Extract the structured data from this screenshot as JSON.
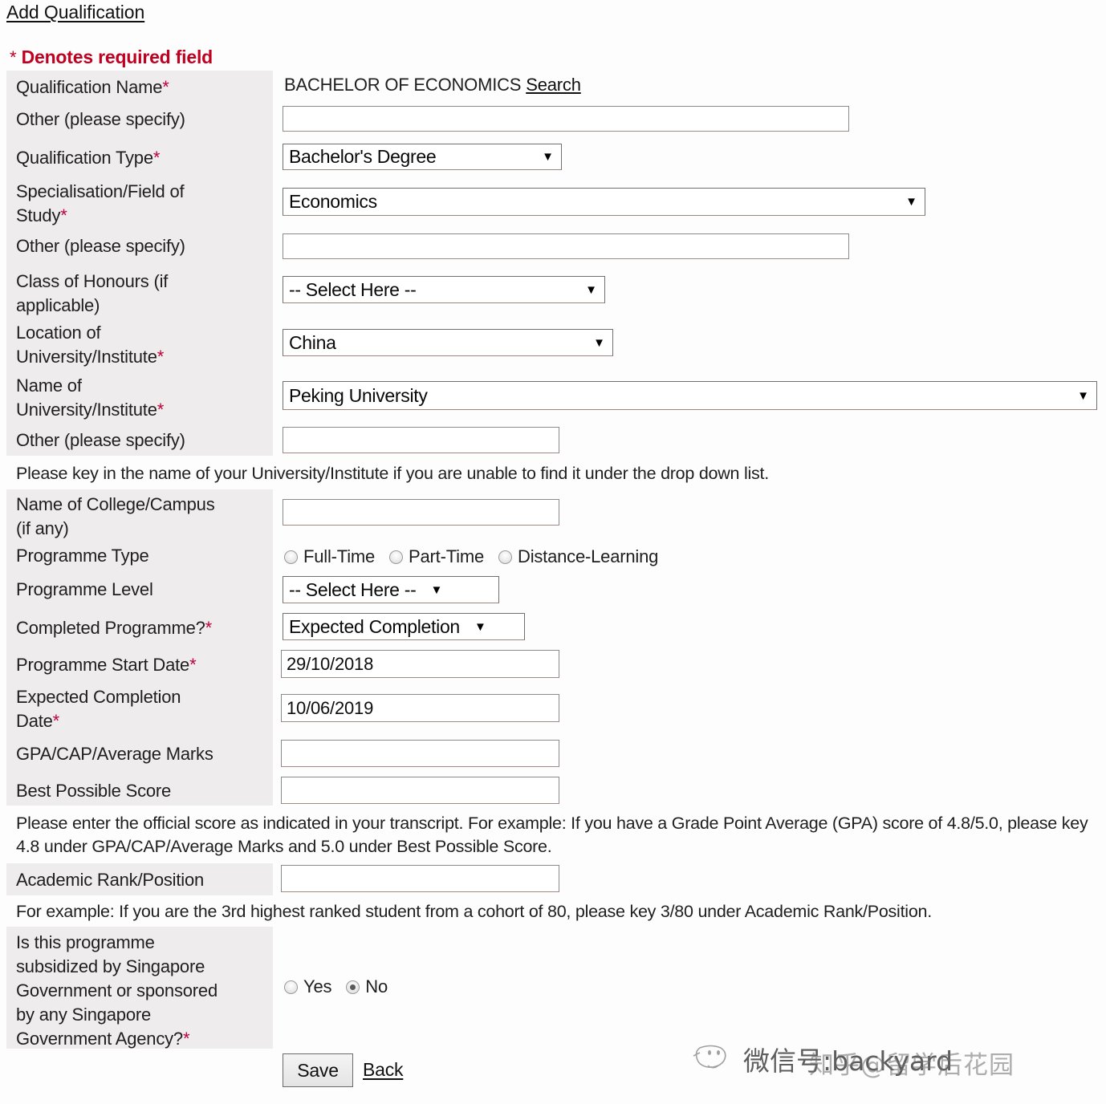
{
  "header": {
    "title_link": "Add Qualification",
    "required_note_star": "*",
    "required_note_text": "Denotes required field"
  },
  "labels": {
    "qualification_name": "Qualification Name",
    "other_specify_1": "Other (please specify)",
    "qualification_type": "Qualification Type",
    "specialisation": "Specialisation/Field of\nStudy",
    "other_specify_2": "Other (please specify)",
    "class_of_honours": "Class of Honours (if\napplicable)",
    "location_of_university": "Location of\nUniversity/Institute",
    "name_of_university": "Name of\nUniversity/Institute",
    "other_specify_3": "Other (please specify)",
    "name_of_college": "Name of College/Campus\n(if any)",
    "programme_type": "Programme Type",
    "programme_level": "Programme Level",
    "completed_programme": "Completed Programme?",
    "programme_start_date": "Programme Start Date",
    "expected_completion_date": "Expected Completion\nDate",
    "gpa": "GPA/CAP/Average Marks",
    "best_possible_score": "Best Possible Score",
    "academic_rank": "Academic Rank/Position",
    "subsidized_question": "Is this programme\nsubsidized by Singapore\nGovernment or sponsored\nby any Singapore\nGovernment Agency?",
    "required_marker": "*"
  },
  "fields": {
    "qualification_name_value": "BACHELOR OF ECONOMICS",
    "qualification_name_search": "Search",
    "other_specify_1_value": "",
    "qualification_type_value": "Bachelor's Degree",
    "specialisation_value": "Economics",
    "other_specify_2_value": "",
    "class_of_honours_value": "-- Select Here --",
    "location_value": "China",
    "university_value": "Peking University",
    "other_specify_3_value": "",
    "college_campus_value": "",
    "programme_level_value": "-- Select Here --",
    "completed_programme_value": "Expected Completion",
    "programme_start_date_value": "29/10/2018",
    "expected_completion_date_value": "10/06/2019",
    "gpa_value": "",
    "best_possible_score_value": "",
    "academic_rank_value": "",
    "dropdown_arrow": "▼"
  },
  "programme_type_options": [
    {
      "label": "Full-Time",
      "checked": false
    },
    {
      "label": "Part-Time",
      "checked": false
    },
    {
      "label": "Distance-Learning",
      "checked": false
    }
  ],
  "subsidized_options": [
    {
      "label": "Yes",
      "checked": false
    },
    {
      "label": "No",
      "checked": true
    }
  ],
  "helper_text": {
    "university_hint": "Please key in the name of your University/Institute if you are unable to find it under the drop down list.",
    "score_hint": "Please enter the official score as indicated in your transcript. For example: If you have a Grade Point Average (GPA) score of 4.8/5.0, please key 4.8 under GPA/CAP/Average Marks and 5.0 under Best Possible Score.",
    "rank_hint": "For example: If you are the 3rd highest ranked student from a cohort of 80, please key 3/80 under Academic Rank/Position."
  },
  "actions": {
    "save_label": "Save",
    "back_label": "Back"
  },
  "watermark": {
    "line_a": "微信号:backyard",
    "line_b": "知乎@留学后花园"
  },
  "colors": {
    "required_red": "#c00020",
    "asterisk_red": "#c0003a",
    "panel_grey": "#eeeced",
    "page_bg": "#fdfdfd"
  }
}
